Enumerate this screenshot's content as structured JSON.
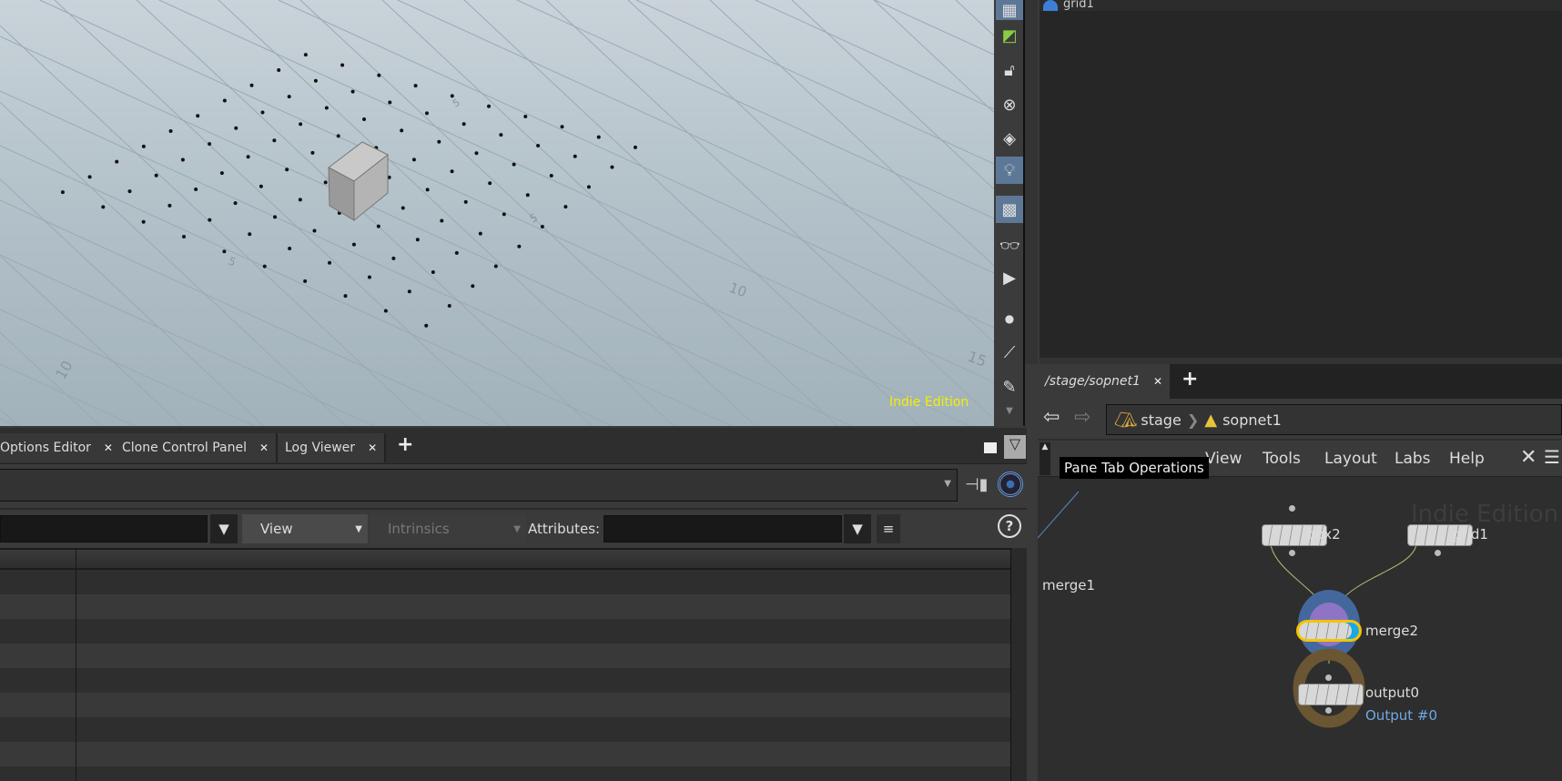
{
  "viewport": {
    "watermark": "Indie Edition",
    "grid_labels": [
      "10",
      "5",
      "10",
      "15",
      "5",
      "5"
    ]
  },
  "viewport_toolbar": {
    "icons": [
      "display-options-icon",
      "ghost-icon",
      "lock-icon",
      "no-light-icon",
      "headlight-icon",
      "light-icon",
      "shading-icon",
      "stereo-icon",
      "camera-view-icon",
      "point-icon",
      "brush-icon",
      "pick-icon"
    ]
  },
  "details_pane": {
    "item_label": "grid1"
  },
  "bottom_left": {
    "tabs": [
      {
        "label": "Options Editor"
      },
      {
        "label": "Clone Control Panel"
      },
      {
        "label": "Log Viewer"
      }
    ],
    "add_tab": "+",
    "view_select": "View",
    "intrinsics_select": "Intrinsics",
    "attributes_label": "Attributes:",
    "help": "?"
  },
  "network": {
    "tab": "/stage/sopnet1",
    "add_tab": "+",
    "breadcrumb": [
      {
        "label": "stage"
      },
      {
        "label": "sopnet1"
      }
    ],
    "menu": [
      "View",
      "Tools",
      "Layout",
      "Labs",
      "Help"
    ],
    "tooltip": "Pane Tab Operations",
    "watermark": "Indie Edition",
    "nodes": {
      "box2": "box2",
      "grid1": "grid1",
      "merge1": "merge1",
      "merge2": "merge2",
      "output0": "output0",
      "output_label": "Output #0"
    }
  },
  "colors": {
    "watermark": "#f3f000",
    "selection": "#f5c400",
    "output_link": "#6fa8e6"
  }
}
